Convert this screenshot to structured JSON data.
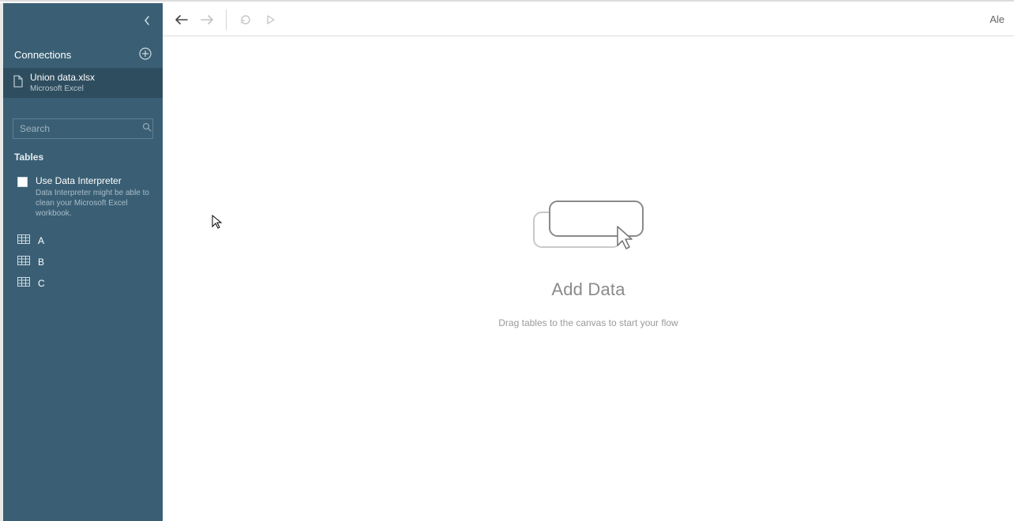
{
  "sidebar": {
    "connections_label": "Connections",
    "connection": {
      "title": "Union data.xlsx",
      "subtitle": "Microsoft Excel"
    },
    "search": {
      "placeholder": "Search"
    },
    "tables_label": "Tables",
    "interpreter": {
      "title": "Use Data Interpreter",
      "desc": "Data Interpreter might be able to clean your Microsoft Excel workbook."
    },
    "tables": [
      {
        "name": "A"
      },
      {
        "name": "B"
      },
      {
        "name": "C"
      }
    ]
  },
  "toolbar": {
    "alerts_label": "Ale"
  },
  "canvas": {
    "title": "Add Data",
    "subtitle": "Drag tables to the canvas to start your flow"
  }
}
